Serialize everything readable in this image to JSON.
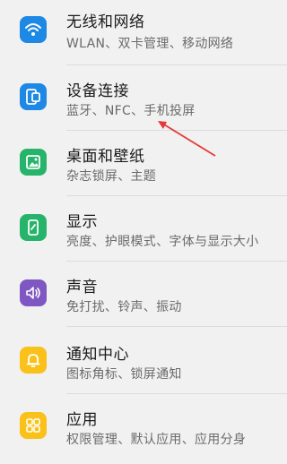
{
  "settings": {
    "items": [
      {
        "title": "无线和网络",
        "subtitle": "WLAN、双卡管理、移动网络",
        "icon": "wifi-icon",
        "color": "#1e88e5"
      },
      {
        "title": "设备连接",
        "subtitle": "蓝牙、NFC、手机投屏",
        "icon": "device-connect-icon",
        "color": "#1e88e5"
      },
      {
        "title": "桌面和壁纸",
        "subtitle": "杂志锁屏、主题",
        "icon": "wallpaper-icon",
        "color": "#26b46a"
      },
      {
        "title": "显示",
        "subtitle": "亮度、护眼模式、字体与显示大小",
        "icon": "display-icon",
        "color": "#26b46a"
      },
      {
        "title": "声音",
        "subtitle": "免打扰、铃声、振动",
        "icon": "sound-icon",
        "color": "#7e57c2"
      },
      {
        "title": "通知中心",
        "subtitle": "图标角标、锁屏通知",
        "icon": "bell-icon",
        "color": "#f9c11a"
      },
      {
        "title": "应用",
        "subtitle": "权限管理、默认应用、应用分身",
        "icon": "apps-icon",
        "color": "#f9c11a"
      }
    ]
  },
  "annotation": {
    "arrow_color": "#e53935"
  }
}
